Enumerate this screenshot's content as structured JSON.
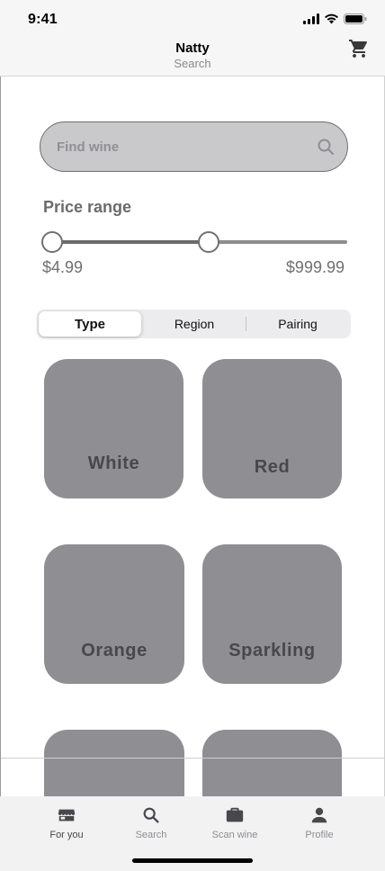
{
  "status": {
    "time": "9:41"
  },
  "nav": {
    "title": "Natty",
    "subtitle": "Search",
    "cart_icon": "cart-icon"
  },
  "search": {
    "placeholder": "Find wine",
    "value": "",
    "icon": "search-icon"
  },
  "price": {
    "label": "Price range",
    "min_label": "$4.99",
    "max_label": "$999.99",
    "selected_fraction": [
      0.0,
      0.55
    ]
  },
  "segments": {
    "items": [
      {
        "label": "Type",
        "active": true
      },
      {
        "label": "Region",
        "active": false
      },
      {
        "label": "Pairing",
        "active": false
      }
    ]
  },
  "tiles": [
    {
      "label": "White"
    },
    {
      "label": "Red"
    },
    {
      "label": "Orange"
    },
    {
      "label": "Sparkling"
    },
    {
      "label": ""
    },
    {
      "label": ""
    }
  ],
  "tabs": [
    {
      "label": "For you",
      "icon": "store-icon",
      "active": true
    },
    {
      "label": "Search",
      "icon": "search-icon",
      "active": false
    },
    {
      "label": "Scan wine",
      "icon": "briefcase-icon",
      "active": false
    },
    {
      "label": "Profile",
      "icon": "person-icon",
      "active": false
    }
  ],
  "colors": {
    "tile": "#8e8e93",
    "accent": "#6b6b6b",
    "background": "#ffffff"
  }
}
